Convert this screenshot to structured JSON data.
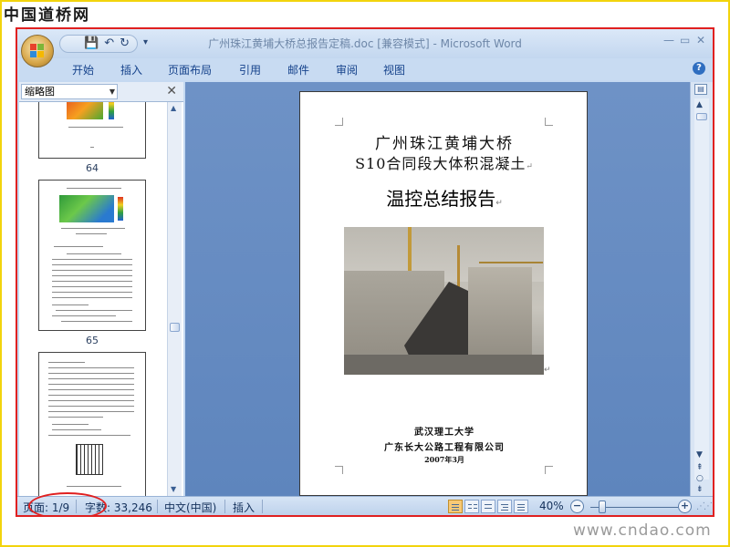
{
  "watermark": {
    "site_logo": "中国道桥网",
    "site_url": "www.cndao.com"
  },
  "titlebar": {
    "title": "广州珠江黄埔大桥总报告定稿.doc [兼容模式] - Microsoft Word",
    "minimize_icon": "minimize-icon",
    "maximize_icon": "maximize-icon",
    "close_icon": "close-icon"
  },
  "quick_access": {
    "save_icon": "save-icon",
    "undo_icon": "undo-icon",
    "redo_icon": "redo-icon",
    "customize_icon": "chevron-down-icon"
  },
  "ribbon": {
    "tabs": [
      "开始",
      "插入",
      "页面布局",
      "引用",
      "邮件",
      "审阅",
      "视图"
    ],
    "help_icon": "help-icon"
  },
  "thumbnail_pane": {
    "title": "缩略图",
    "pages": [
      {
        "label": "64"
      },
      {
        "label": "65"
      }
    ]
  },
  "document": {
    "line1": "广州珠江黄埔大桥",
    "line2": "S10合同段大体积混凝土",
    "line3": "温控总结报告",
    "para_mark": "↵",
    "signature1": "武汉理工大学",
    "signature2": "广东长大公路工程有限公司",
    "date": "2007年3月"
  },
  "statusbar": {
    "page_label": "页面: 1/9",
    "word_count_label": "字数: 33,246",
    "language": "中文(中国)",
    "mode": "插入",
    "zoom": "40%",
    "zoom_level": 0.4,
    "zoom_out": "−",
    "zoom_in": "+"
  },
  "colors": {
    "highlight": "#e02020",
    "accent_frame": "#f2d40c",
    "ribbon_text": "#15428b",
    "document_bg": "#6e92c6"
  }
}
